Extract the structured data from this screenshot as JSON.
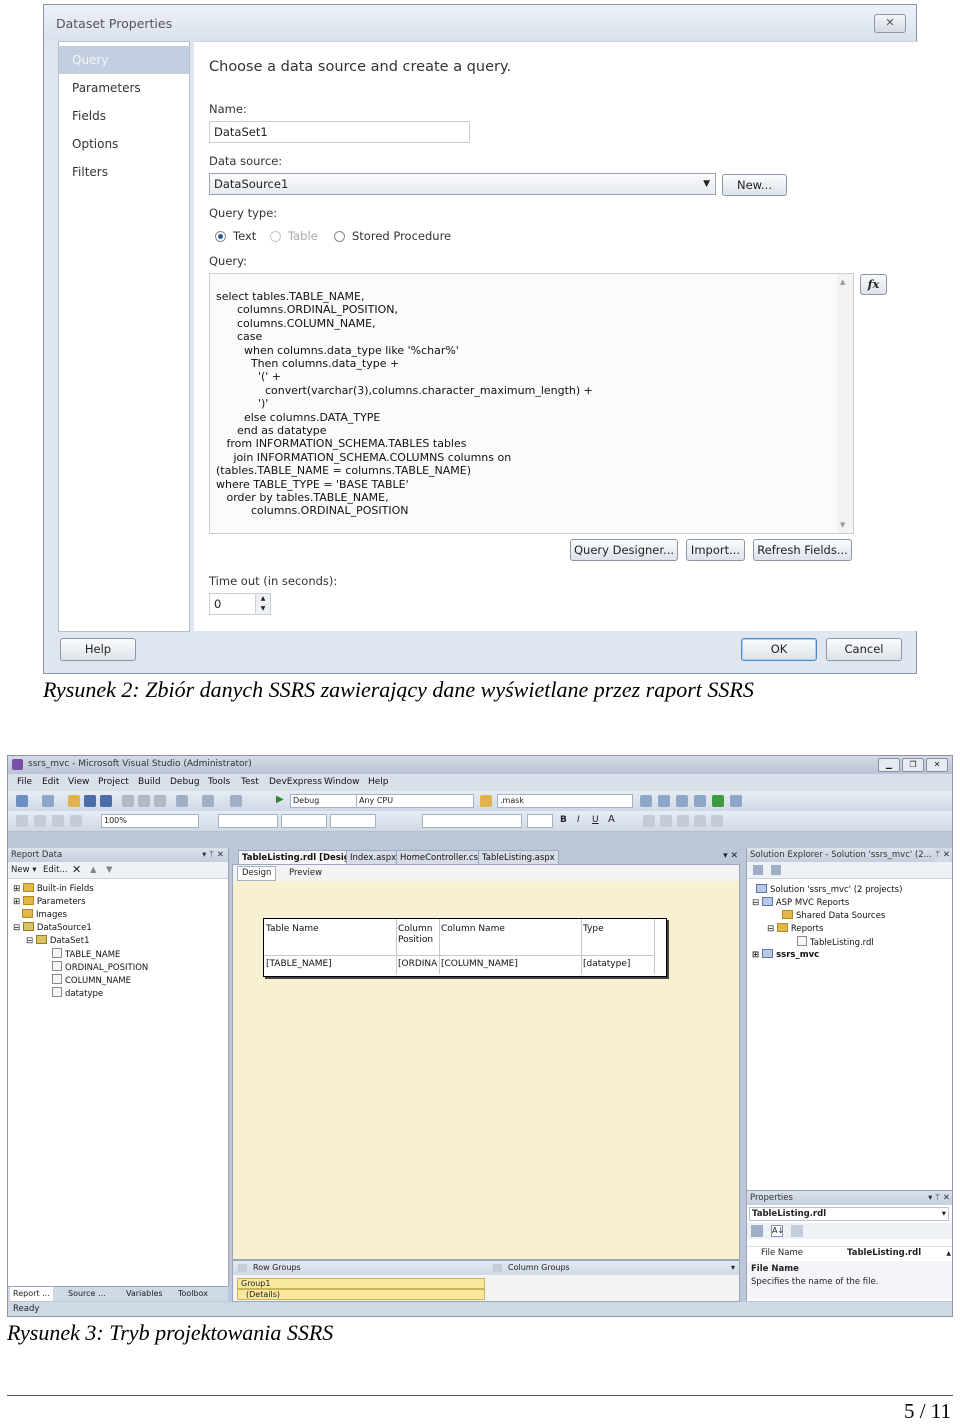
{
  "dialog": {
    "title": "Dataset Properties",
    "close_glyph": "✕",
    "nav": [
      "Query",
      "Parameters",
      "Fields",
      "Options",
      "Filters"
    ],
    "heading": "Choose a data source and create a query.",
    "name_label": "Name:",
    "name_value": "DataSet1",
    "datasource_label": "Data source:",
    "datasource_value": "DataSource1",
    "new_button": "New...",
    "querytype_label": "Query type:",
    "querytype_options": [
      "Text",
      "Table",
      "Stored Procedure"
    ],
    "query_label": "Query:",
    "query_lines": [
      "select tables.TABLE_NAME,",
      "      columns.ORDINAL_POSITION,",
      "      columns.COLUMN_NAME,",
      "      case",
      "        when columns.data_type like '%char%'",
      "          Then columns.data_type +",
      "            '(' +",
      "              convert(varchar(3),columns.character_maximum_length) +",
      "            ')'",
      "        else columns.DATA_TYPE",
      "      end as datatype",
      "   from INFORMATION_SCHEMA.TABLES tables",
      "     join INFORMATION_SCHEMA.COLUMNS columns on",
      "(tables.TABLE_NAME = columns.TABLE_NAME)",
      "where TABLE_TYPE = 'BASE TABLE'",
      "   order by tables.TABLE_NAME,",
      "          columns.ORDINAL_POSITION"
    ],
    "fx_label": "fx",
    "query_designer_button": "Query Designer...",
    "import_button": "Import...",
    "refresh_button": "Refresh Fields...",
    "timeout_label": "Time out (in seconds):",
    "timeout_value": "0",
    "help_button": "Help",
    "ok_button": "OK",
    "cancel_button": "Cancel"
  },
  "caption1": "Rysunek 2: Zbiór danych SSRS zawierający dane wyświetlane przez raport SSRS",
  "vs": {
    "title": "ssrs_mvc - Microsoft Visual Studio (Administrator)",
    "menus": [
      "File",
      "Edit",
      "View",
      "Project",
      "Build",
      "Debug",
      "Tools",
      "Test",
      "DevExpress",
      "Window",
      "Help"
    ],
    "config": "Debug",
    "platform": "Any CPU",
    "find_text": ".mask",
    "zoom": "100%",
    "report_data": {
      "title": "Report Data",
      "new": "New ▾",
      "edit": "Edit...",
      "tree": [
        "Built-in Fields",
        "Parameters",
        "Images",
        "DataSource1",
        "DataSet1",
        "TABLE_NAME",
        "ORDINAL_POSITION",
        "COLUMN_NAME",
        "datatype"
      ]
    },
    "bottom_tabs": [
      "Report ...",
      "Source ...",
      "Variables",
      "Toolbox"
    ],
    "doc_tabs": [
      "TableListing.rdl [Design]",
      "Index.aspx",
      "HomeController.cs",
      "TableListing.aspx"
    ],
    "design_tab": "Design",
    "preview_tab": "Preview",
    "table_headers": [
      "Table Name",
      "Column Position",
      "Column Name",
      "Type"
    ],
    "table_row": [
      "[TABLE_NAME]",
      "[ORDINA",
      "[COLUMN_NAME]",
      "[datatype]"
    ],
    "row_groups": "Row Groups",
    "column_groups": "Column Groups",
    "groups": [
      "Group1",
      "(Details)"
    ],
    "solution_explorer": {
      "title": "Solution Explorer - Solution 'ssrs_mvc' (2...",
      "tree": [
        "Solution 'ssrs_mvc' (2 projects)",
        "ASP MVC Reports",
        "Shared Data Sources",
        "Reports",
        "TableListing.rdl",
        "ssrs_mvc"
      ]
    },
    "properties": {
      "title": "Properties",
      "object": "TableListing.rdl",
      "prop_name": "File Name",
      "prop_value": "TableListing.rdl",
      "desc_title": "File Name",
      "desc_text": "Specifies the name of the file."
    },
    "status": "Ready"
  },
  "caption2": "Rysunek 3: Tryb projektowania SSRS",
  "page_number": "5 / 11"
}
